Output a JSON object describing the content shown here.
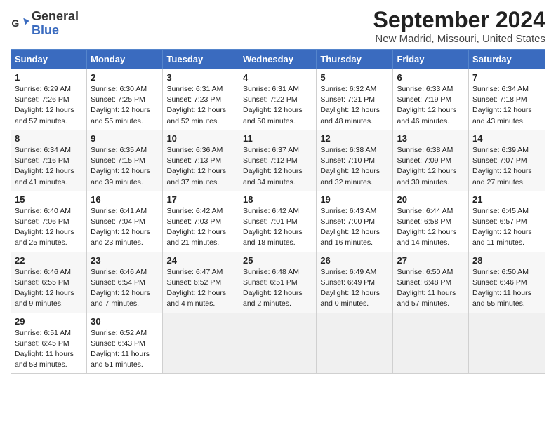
{
  "header": {
    "logo_line1": "General",
    "logo_line2": "Blue",
    "title": "September 2024",
    "subtitle": "New Madrid, Missouri, United States"
  },
  "days_of_week": [
    "Sunday",
    "Monday",
    "Tuesday",
    "Wednesday",
    "Thursday",
    "Friday",
    "Saturday"
  ],
  "weeks": [
    [
      {
        "day": "1",
        "text": "Sunrise: 6:29 AM\nSunset: 7:26 PM\nDaylight: 12 hours\nand 57 minutes."
      },
      {
        "day": "2",
        "text": "Sunrise: 6:30 AM\nSunset: 7:25 PM\nDaylight: 12 hours\nand 55 minutes."
      },
      {
        "day": "3",
        "text": "Sunrise: 6:31 AM\nSunset: 7:23 PM\nDaylight: 12 hours\nand 52 minutes."
      },
      {
        "day": "4",
        "text": "Sunrise: 6:31 AM\nSunset: 7:22 PM\nDaylight: 12 hours\nand 50 minutes."
      },
      {
        "day": "5",
        "text": "Sunrise: 6:32 AM\nSunset: 7:21 PM\nDaylight: 12 hours\nand 48 minutes."
      },
      {
        "day": "6",
        "text": "Sunrise: 6:33 AM\nSunset: 7:19 PM\nDaylight: 12 hours\nand 46 minutes."
      },
      {
        "day": "7",
        "text": "Sunrise: 6:34 AM\nSunset: 7:18 PM\nDaylight: 12 hours\nand 43 minutes."
      }
    ],
    [
      {
        "day": "8",
        "text": "Sunrise: 6:34 AM\nSunset: 7:16 PM\nDaylight: 12 hours\nand 41 minutes."
      },
      {
        "day": "9",
        "text": "Sunrise: 6:35 AM\nSunset: 7:15 PM\nDaylight: 12 hours\nand 39 minutes."
      },
      {
        "day": "10",
        "text": "Sunrise: 6:36 AM\nSunset: 7:13 PM\nDaylight: 12 hours\nand 37 minutes."
      },
      {
        "day": "11",
        "text": "Sunrise: 6:37 AM\nSunset: 7:12 PM\nDaylight: 12 hours\nand 34 minutes."
      },
      {
        "day": "12",
        "text": "Sunrise: 6:38 AM\nSunset: 7:10 PM\nDaylight: 12 hours\nand 32 minutes."
      },
      {
        "day": "13",
        "text": "Sunrise: 6:38 AM\nSunset: 7:09 PM\nDaylight: 12 hours\nand 30 minutes."
      },
      {
        "day": "14",
        "text": "Sunrise: 6:39 AM\nSunset: 7:07 PM\nDaylight: 12 hours\nand 27 minutes."
      }
    ],
    [
      {
        "day": "15",
        "text": "Sunrise: 6:40 AM\nSunset: 7:06 PM\nDaylight: 12 hours\nand 25 minutes."
      },
      {
        "day": "16",
        "text": "Sunrise: 6:41 AM\nSunset: 7:04 PM\nDaylight: 12 hours\nand 23 minutes."
      },
      {
        "day": "17",
        "text": "Sunrise: 6:42 AM\nSunset: 7:03 PM\nDaylight: 12 hours\nand 21 minutes."
      },
      {
        "day": "18",
        "text": "Sunrise: 6:42 AM\nSunset: 7:01 PM\nDaylight: 12 hours\nand 18 minutes."
      },
      {
        "day": "19",
        "text": "Sunrise: 6:43 AM\nSunset: 7:00 PM\nDaylight: 12 hours\nand 16 minutes."
      },
      {
        "day": "20",
        "text": "Sunrise: 6:44 AM\nSunset: 6:58 PM\nDaylight: 12 hours\nand 14 minutes."
      },
      {
        "day": "21",
        "text": "Sunrise: 6:45 AM\nSunset: 6:57 PM\nDaylight: 12 hours\nand 11 minutes."
      }
    ],
    [
      {
        "day": "22",
        "text": "Sunrise: 6:46 AM\nSunset: 6:55 PM\nDaylight: 12 hours\nand 9 minutes."
      },
      {
        "day": "23",
        "text": "Sunrise: 6:46 AM\nSunset: 6:54 PM\nDaylight: 12 hours\nand 7 minutes."
      },
      {
        "day": "24",
        "text": "Sunrise: 6:47 AM\nSunset: 6:52 PM\nDaylight: 12 hours\nand 4 minutes."
      },
      {
        "day": "25",
        "text": "Sunrise: 6:48 AM\nSunset: 6:51 PM\nDaylight: 12 hours\nand 2 minutes."
      },
      {
        "day": "26",
        "text": "Sunrise: 6:49 AM\nSunset: 6:49 PM\nDaylight: 12 hours\nand 0 minutes."
      },
      {
        "day": "27",
        "text": "Sunrise: 6:50 AM\nSunset: 6:48 PM\nDaylight: 11 hours\nand 57 minutes."
      },
      {
        "day": "28",
        "text": "Sunrise: 6:50 AM\nSunset: 6:46 PM\nDaylight: 11 hours\nand 55 minutes."
      }
    ],
    [
      {
        "day": "29",
        "text": "Sunrise: 6:51 AM\nSunset: 6:45 PM\nDaylight: 11 hours\nand 53 minutes."
      },
      {
        "day": "30",
        "text": "Sunrise: 6:52 AM\nSunset: 6:43 PM\nDaylight: 11 hours\nand 51 minutes."
      },
      {
        "day": "",
        "text": ""
      },
      {
        "day": "",
        "text": ""
      },
      {
        "day": "",
        "text": ""
      },
      {
        "day": "",
        "text": ""
      },
      {
        "day": "",
        "text": ""
      }
    ]
  ]
}
